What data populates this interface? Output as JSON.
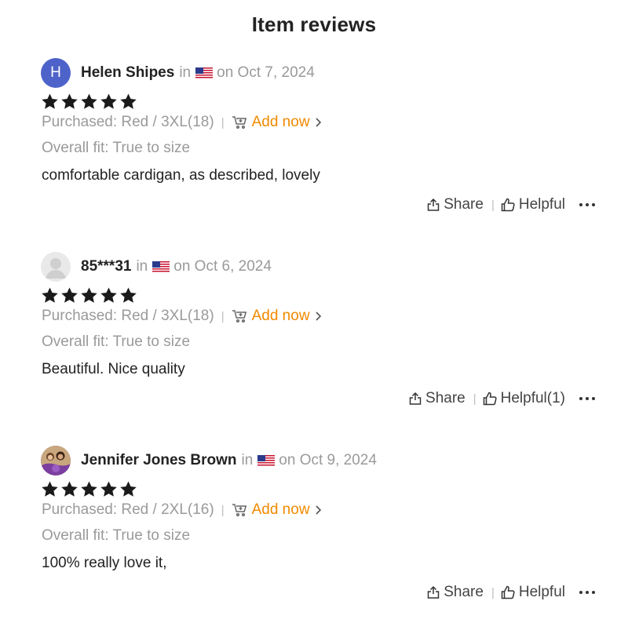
{
  "page": {
    "title": "Item reviews"
  },
  "reviews": [
    {
      "avatar_letter": "H",
      "name": "Helen Shipes",
      "in_text": "in",
      "date": "on Oct 7, 2024",
      "rating": 5,
      "purchased": "Purchased: Red / 3XL(18)",
      "add_now": "Add now",
      "fit": "Overall fit: True to size",
      "comment": "comfortable cardigan, as described, lovely",
      "share": "Share",
      "helpful": "Helpful"
    },
    {
      "avatar_letter": "",
      "name": "85***31",
      "in_text": "in",
      "date": "on Oct 6, 2024",
      "rating": 5,
      "purchased": "Purchased: Red / 3XL(18)",
      "add_now": "Add now",
      "fit": "Overall fit: True to size",
      "comment": "Beautiful. Nice quality",
      "share": "Share",
      "helpful": "Helpful(1)"
    },
    {
      "avatar_letter": "",
      "name": "Jennifer Jones Brown",
      "in_text": "in",
      "date": "on Oct 9, 2024",
      "rating": 5,
      "purchased": "Purchased: Red / 2XL(16)",
      "add_now": "Add now",
      "fit": "Overall fit: True to size",
      "comment": "100% really love it,",
      "share": "Share",
      "helpful": "Helpful"
    }
  ],
  "icons": {
    "flag": "us-flag-icon",
    "cart": "cart-add-icon",
    "share": "share-icon",
    "helpful": "thumbs-up-icon",
    "more": "more-dots-icon"
  },
  "colors": {
    "accent": "#f08a00",
    "avatar": "#4e63c9",
    "muted": "#9a9a9a"
  }
}
